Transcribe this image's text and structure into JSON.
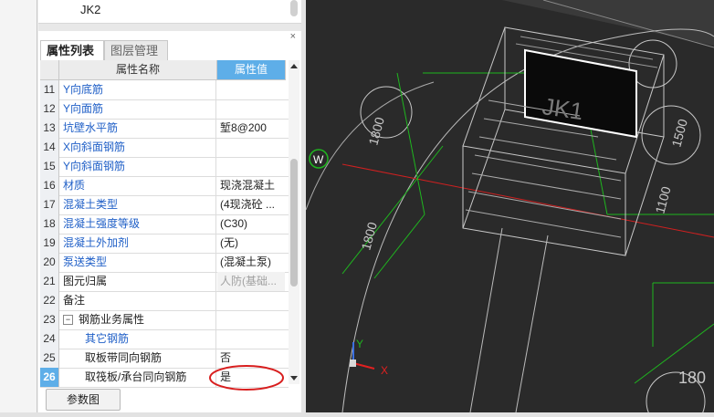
{
  "tree_item": "JK2",
  "tabs": {
    "props": "属性列表",
    "layers": "图层管理"
  },
  "columns": {
    "name": "属性名称",
    "value": "属性值"
  },
  "rows": [
    {
      "n": "11",
      "name": "Y向底筋",
      "value": ""
    },
    {
      "n": "12",
      "name": "Y向面筋",
      "value": ""
    },
    {
      "n": "13",
      "name": "坑壁水平筋",
      "value": "堑8@200"
    },
    {
      "n": "14",
      "name": "X向斜面钢筋",
      "value": ""
    },
    {
      "n": "15",
      "name": "Y向斜面钢筋",
      "value": ""
    },
    {
      "n": "16",
      "name": "材质",
      "value": "现浇混凝土"
    },
    {
      "n": "17",
      "name": "混凝土类型",
      "value": "(4现浇砼 ..."
    },
    {
      "n": "18",
      "name": "混凝土强度等级",
      "value": "(C30)"
    },
    {
      "n": "19",
      "name": "混凝土外加剂",
      "value": "(无)"
    },
    {
      "n": "20",
      "name": "泵送类型",
      "value": "(混凝土泵)"
    },
    {
      "n": "21",
      "name": "图元归属",
      "value": "人防(基础..."
    },
    {
      "n": "22",
      "name": "备注",
      "value": ""
    },
    {
      "n": "23",
      "name": "钢筋业务属性",
      "value": "",
      "toggle": "−"
    },
    {
      "n": "24",
      "name": "其它钢筋",
      "value": ""
    },
    {
      "n": "25",
      "name": "取板带同向钢筋",
      "value": "否"
    },
    {
      "n": "26",
      "name": "取筏板/承台同向钢筋",
      "value": "是"
    }
  ],
  "button_label": "参数图",
  "cad": {
    "element_label": "JK1",
    "dims": [
      "1800",
      "1800",
      "1500",
      "1100",
      "180"
    ],
    "compass": "W",
    "axis_x": "X",
    "axis_y": "Y"
  },
  "colors": {
    "link_blue": "#1f5fc7",
    "header_blue": "#5eaee8",
    "highlight_red": "#d81e1e",
    "cad_bg": "#2a2a2a",
    "cad_green": "#1fb61f",
    "cad_red": "#d02020"
  }
}
